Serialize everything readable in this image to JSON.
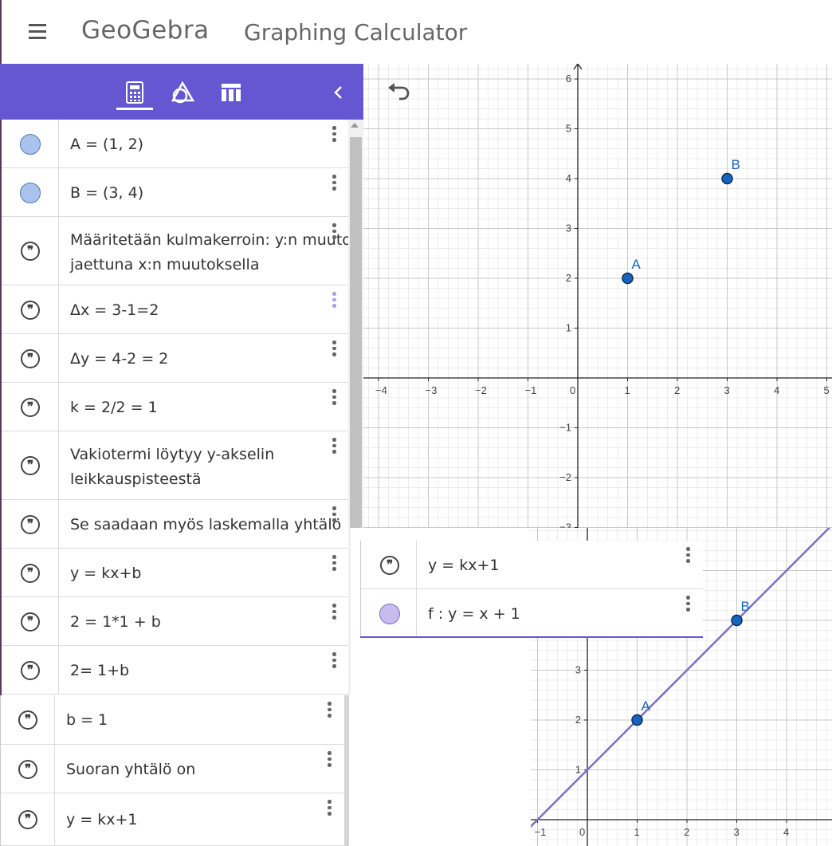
{
  "app": {
    "logo": "GeoGebra",
    "title": "Graphing Calculator"
  },
  "colors": {
    "header": "#6557d2",
    "point": "#1565c0",
    "line": "#7b6fc4"
  },
  "header_tabs": [
    {
      "name": "algebra-tab",
      "icon": "calculator-icon",
      "active": true
    },
    {
      "name": "tools-tab",
      "icon": "geometry-shapes-icon"
    },
    {
      "name": "table-tab",
      "icon": "table-icon"
    }
  ],
  "algebra": {
    "items": [
      {
        "kind": "point",
        "text": "A = (1, 2)"
      },
      {
        "kind": "point",
        "text": "B = (3, 4)"
      },
      {
        "kind": "text",
        "line1": "Määritetään kulmakerroin: y:n muuto",
        "line2": "jaettuna x:n muutoksella"
      },
      {
        "kind": "text",
        "text": "Δx = 3-1=2"
      },
      {
        "kind": "text",
        "text": "Δy = 4-2 = 2"
      },
      {
        "kind": "text",
        "text": "k = 2/2 = 1"
      },
      {
        "kind": "text",
        "line1": "Vakiotermi löytyy y-akselin",
        "line2": "leikkauspisteestä"
      },
      {
        "kind": "text",
        "text": "Se saadaan myös laskemalla yhtälö"
      },
      {
        "kind": "text",
        "text": "y = kx+b"
      },
      {
        "kind": "text",
        "text": "2 = 1*1 + b"
      },
      {
        "kind": "text",
        "text": "2= 1+b"
      }
    ],
    "lower_items": [
      {
        "kind": "text",
        "text": "b = 1"
      },
      {
        "kind": "text",
        "text": "Suoran yhtälö on"
      },
      {
        "kind": "text",
        "text": "y = kx+1"
      }
    ],
    "popup_items": [
      {
        "kind": "text",
        "text": "y = kx+1"
      },
      {
        "kind": "function",
        "text": "f : y = x + 1"
      }
    ]
  },
  "graph_main": {
    "x_ticks": [
      "−4",
      "−3",
      "−2",
      "−1",
      "0",
      "1",
      "2",
      "3",
      "4",
      "5"
    ],
    "y_ticks": [
      "6",
      "5",
      "4",
      "3",
      "2",
      "1",
      "−1",
      "−2",
      "−3"
    ],
    "points": [
      {
        "label": "A",
        "x": 1,
        "y": 2
      },
      {
        "label": "B",
        "x": 3,
        "y": 4
      }
    ]
  },
  "graph_zoom": {
    "x_ticks": [
      "−1",
      "0",
      "1",
      "2",
      "3",
      "4"
    ],
    "y_ticks": [
      "3",
      "2",
      "1"
    ],
    "points": [
      {
        "label": "A",
        "x": 1,
        "y": 2
      },
      {
        "label": "B",
        "x": 3,
        "y": 4
      }
    ],
    "line": {
      "slope": 1,
      "intercept": 1
    }
  }
}
